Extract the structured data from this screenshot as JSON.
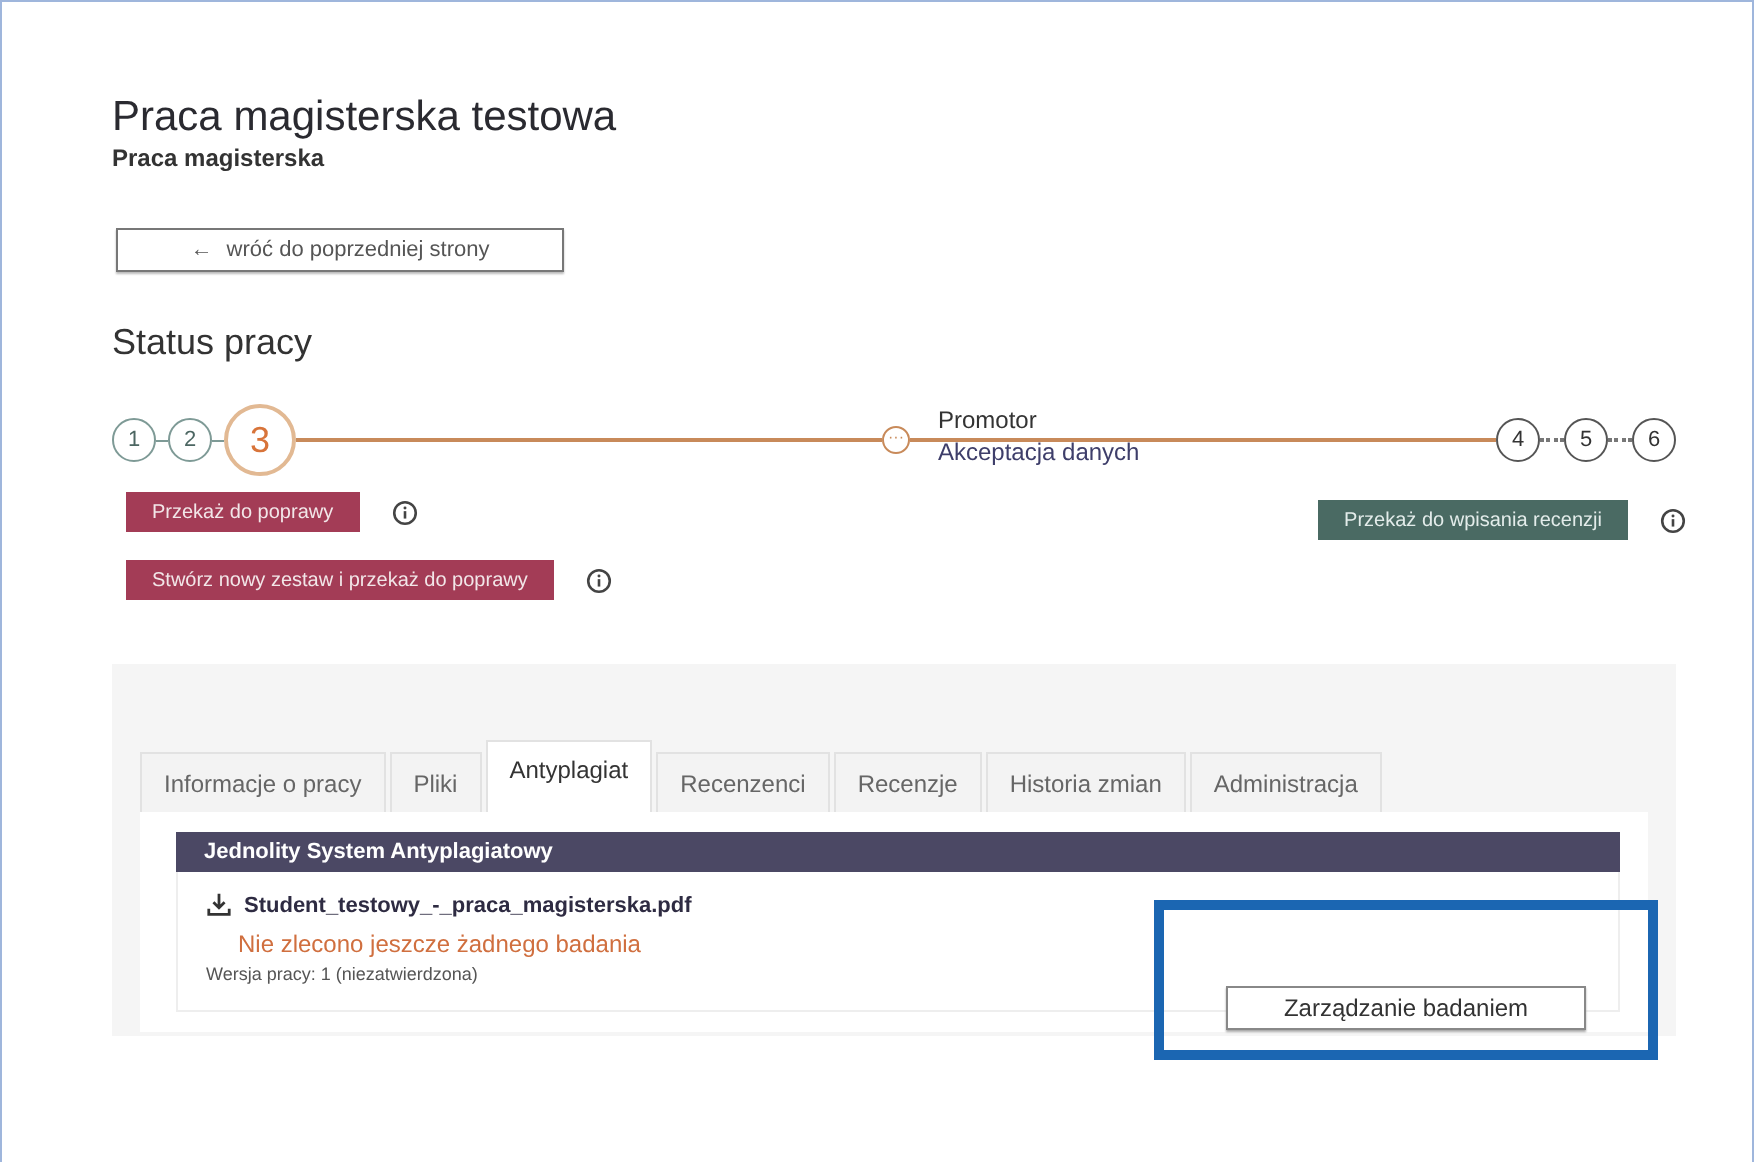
{
  "header": {
    "title": "Praca magisterska testowa",
    "subtitle": "Praca magisterska"
  },
  "back_button": {
    "arrow": "←",
    "label": "wróć do poprzedniej strony"
  },
  "status": {
    "heading": "Status pracy",
    "steps_before": [
      {
        "label": "1",
        "kind": "done"
      },
      {
        "label": "2",
        "kind": "done"
      },
      {
        "label": "3",
        "kind": "current"
      }
    ],
    "substep": {
      "mark": "···",
      "role": "Promotor",
      "action": "Akceptacja danych"
    },
    "steps_after": [
      {
        "label": "4",
        "kind": "pending"
      },
      {
        "label": "5",
        "kind": "pending"
      },
      {
        "label": "6",
        "kind": "pending"
      }
    ]
  },
  "actions_left": [
    {
      "label": "Przekaż do poprawy",
      "kind": "danger"
    },
    {
      "label": "Stwórz nowy zestaw i przekaż do poprawy",
      "kind": "danger"
    }
  ],
  "actions_right": [
    {
      "label": "Przekaż do wpisania recenzji",
      "kind": "success"
    }
  ],
  "tabs": [
    {
      "label": "Informacje o pracy",
      "selected": false
    },
    {
      "label": "Pliki",
      "selected": false
    },
    {
      "label": "Antyplagiat",
      "selected": true
    },
    {
      "label": "Recenzenci",
      "selected": false
    },
    {
      "label": "Recenzje",
      "selected": false
    },
    {
      "label": "Historia zmian",
      "selected": false
    },
    {
      "label": "Administracja",
      "selected": false
    }
  ],
  "antiplagiarism": {
    "header": "Jednolity System Antyplagiatowy",
    "file": "Student_testowy_-_praca_magisterska.pdf",
    "status": "Nie zlecono jeszcze żadnego badania",
    "version": "Wersja pracy: 1 (niezatwierdzona)",
    "manage_button": "Zarządzanie badaniem",
    "highlighted": true
  }
}
